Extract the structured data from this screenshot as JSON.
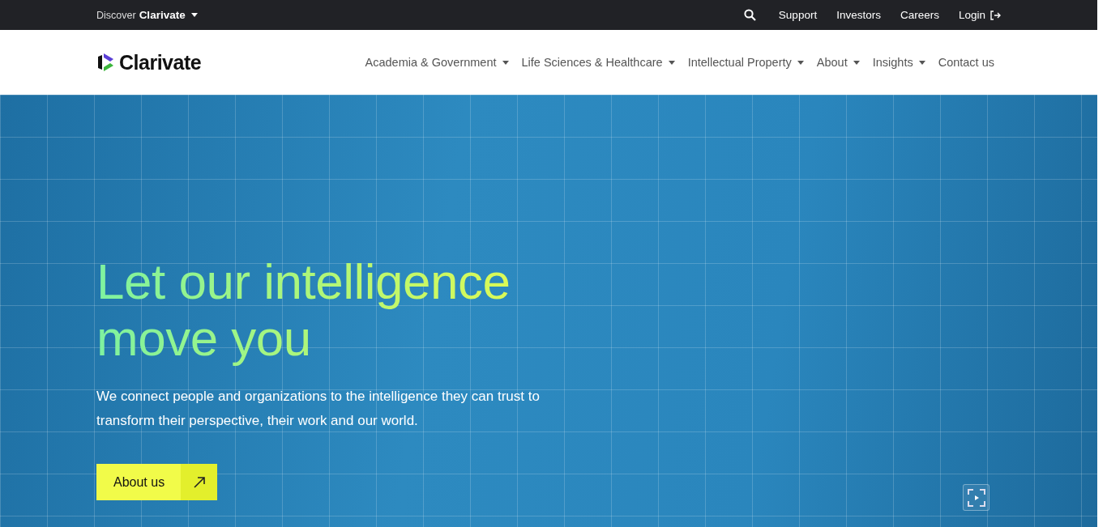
{
  "top_bar": {
    "discover": {
      "prefix": "Discover",
      "brand": "Clarivate"
    },
    "links": [
      {
        "label": "Support"
      },
      {
        "label": "Investors"
      },
      {
        "label": "Careers"
      }
    ],
    "login": "Login"
  },
  "nav": {
    "logo": "Clarivate",
    "items": [
      {
        "label": "Academia & Government",
        "has_dropdown": true
      },
      {
        "label": "Life Sciences & Healthcare",
        "has_dropdown": true
      },
      {
        "label": "Intellectual Property",
        "has_dropdown": true
      },
      {
        "label": "About",
        "has_dropdown": true
      },
      {
        "label": "Insights",
        "has_dropdown": true
      },
      {
        "label": "Contact us",
        "has_dropdown": false
      }
    ]
  },
  "hero": {
    "headline_lines": [
      "Let our intelligence",
      "move you"
    ],
    "body": "We connect people and organizations to the intelligence they can trust to transform their perspective, their work and our world.",
    "button": "About us"
  }
}
